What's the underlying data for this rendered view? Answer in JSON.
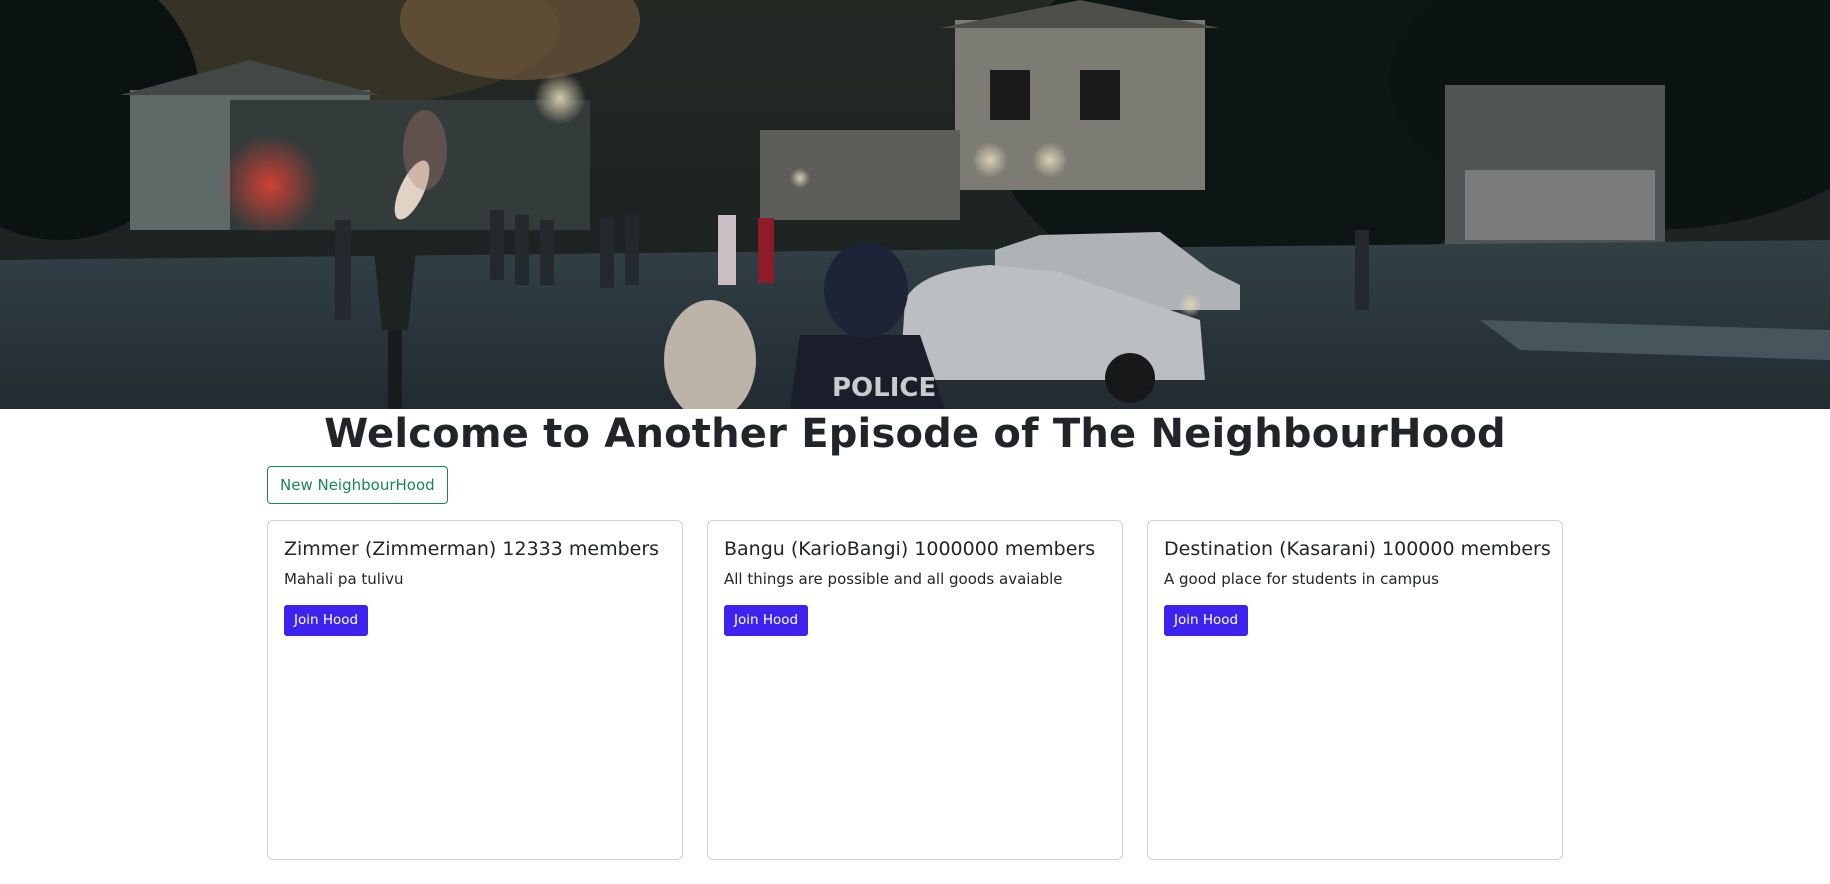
{
  "hero": {
    "image_icon": "neighbourhood-night-street-photo",
    "car_sign": "POLICE"
  },
  "page": {
    "title": "Welcome to Another Episode of The NeighbourHood"
  },
  "actions": {
    "new_hood_label": "New NeighbourHood"
  },
  "hoods": [
    {
      "heading": "Zimmer (Zimmerman) 12333 members",
      "description": "Mahali pa tulivu",
      "join_label": "Join Hood"
    },
    {
      "heading": "Bangu (KarioBangi) 1000000 members",
      "description": "All things are possible and all goods avaiable",
      "join_label": "Join Hood"
    },
    {
      "heading": "Destination (Kasarani) 100000 members",
      "description": "A good place for students in campus",
      "join_label": "Join Hood"
    }
  ],
  "colors": {
    "outline_success": "#198754",
    "primary_button": "#3d22f0",
    "text": "#212529"
  }
}
